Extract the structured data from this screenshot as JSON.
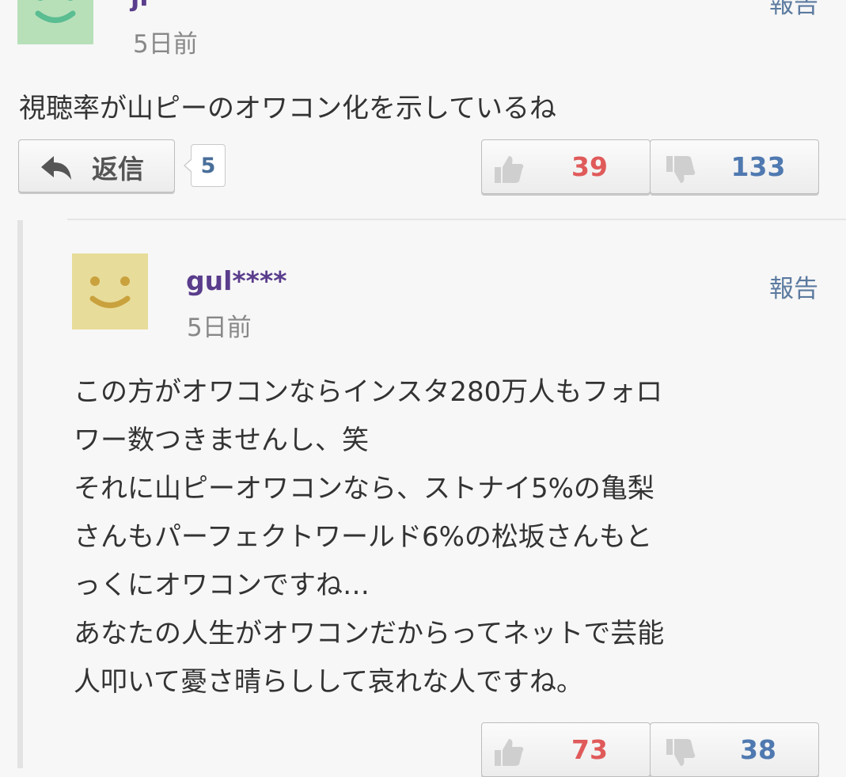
{
  "comments": [
    {
      "username": "ji*",
      "time": "5日前",
      "report_label": "報告",
      "text": "視聴率が山ピーのオワコン化を示しているね",
      "reply_label": "返信",
      "reply_count": "5",
      "likes": "39",
      "dislikes": "133",
      "avatar_color": "#b7e0b9"
    },
    {
      "username": "gul****",
      "time": "5日前",
      "report_label": "報告",
      "text": "この方がオワコンならインスタ280万人もフォロ\nワー数つきませんし、笑\nそれに山ピーオワコンなら、ストナイ5%の亀梨\nさんもパーフェクトワールド6%の松坂さんもと\nっくにオワコンですね…\nあなたの人生がオワコンだからってネットで芸能\n人叩いて憂さ晴らしして哀れな人ですね。",
      "likes": "73",
      "dislikes": "38",
      "avatar_color": "#e8dc9a"
    }
  ],
  "colors": {
    "like": "#e05a5a",
    "dislike": "#4f79b0",
    "username": "#5a3d8c",
    "link": "#5b7a9f"
  }
}
